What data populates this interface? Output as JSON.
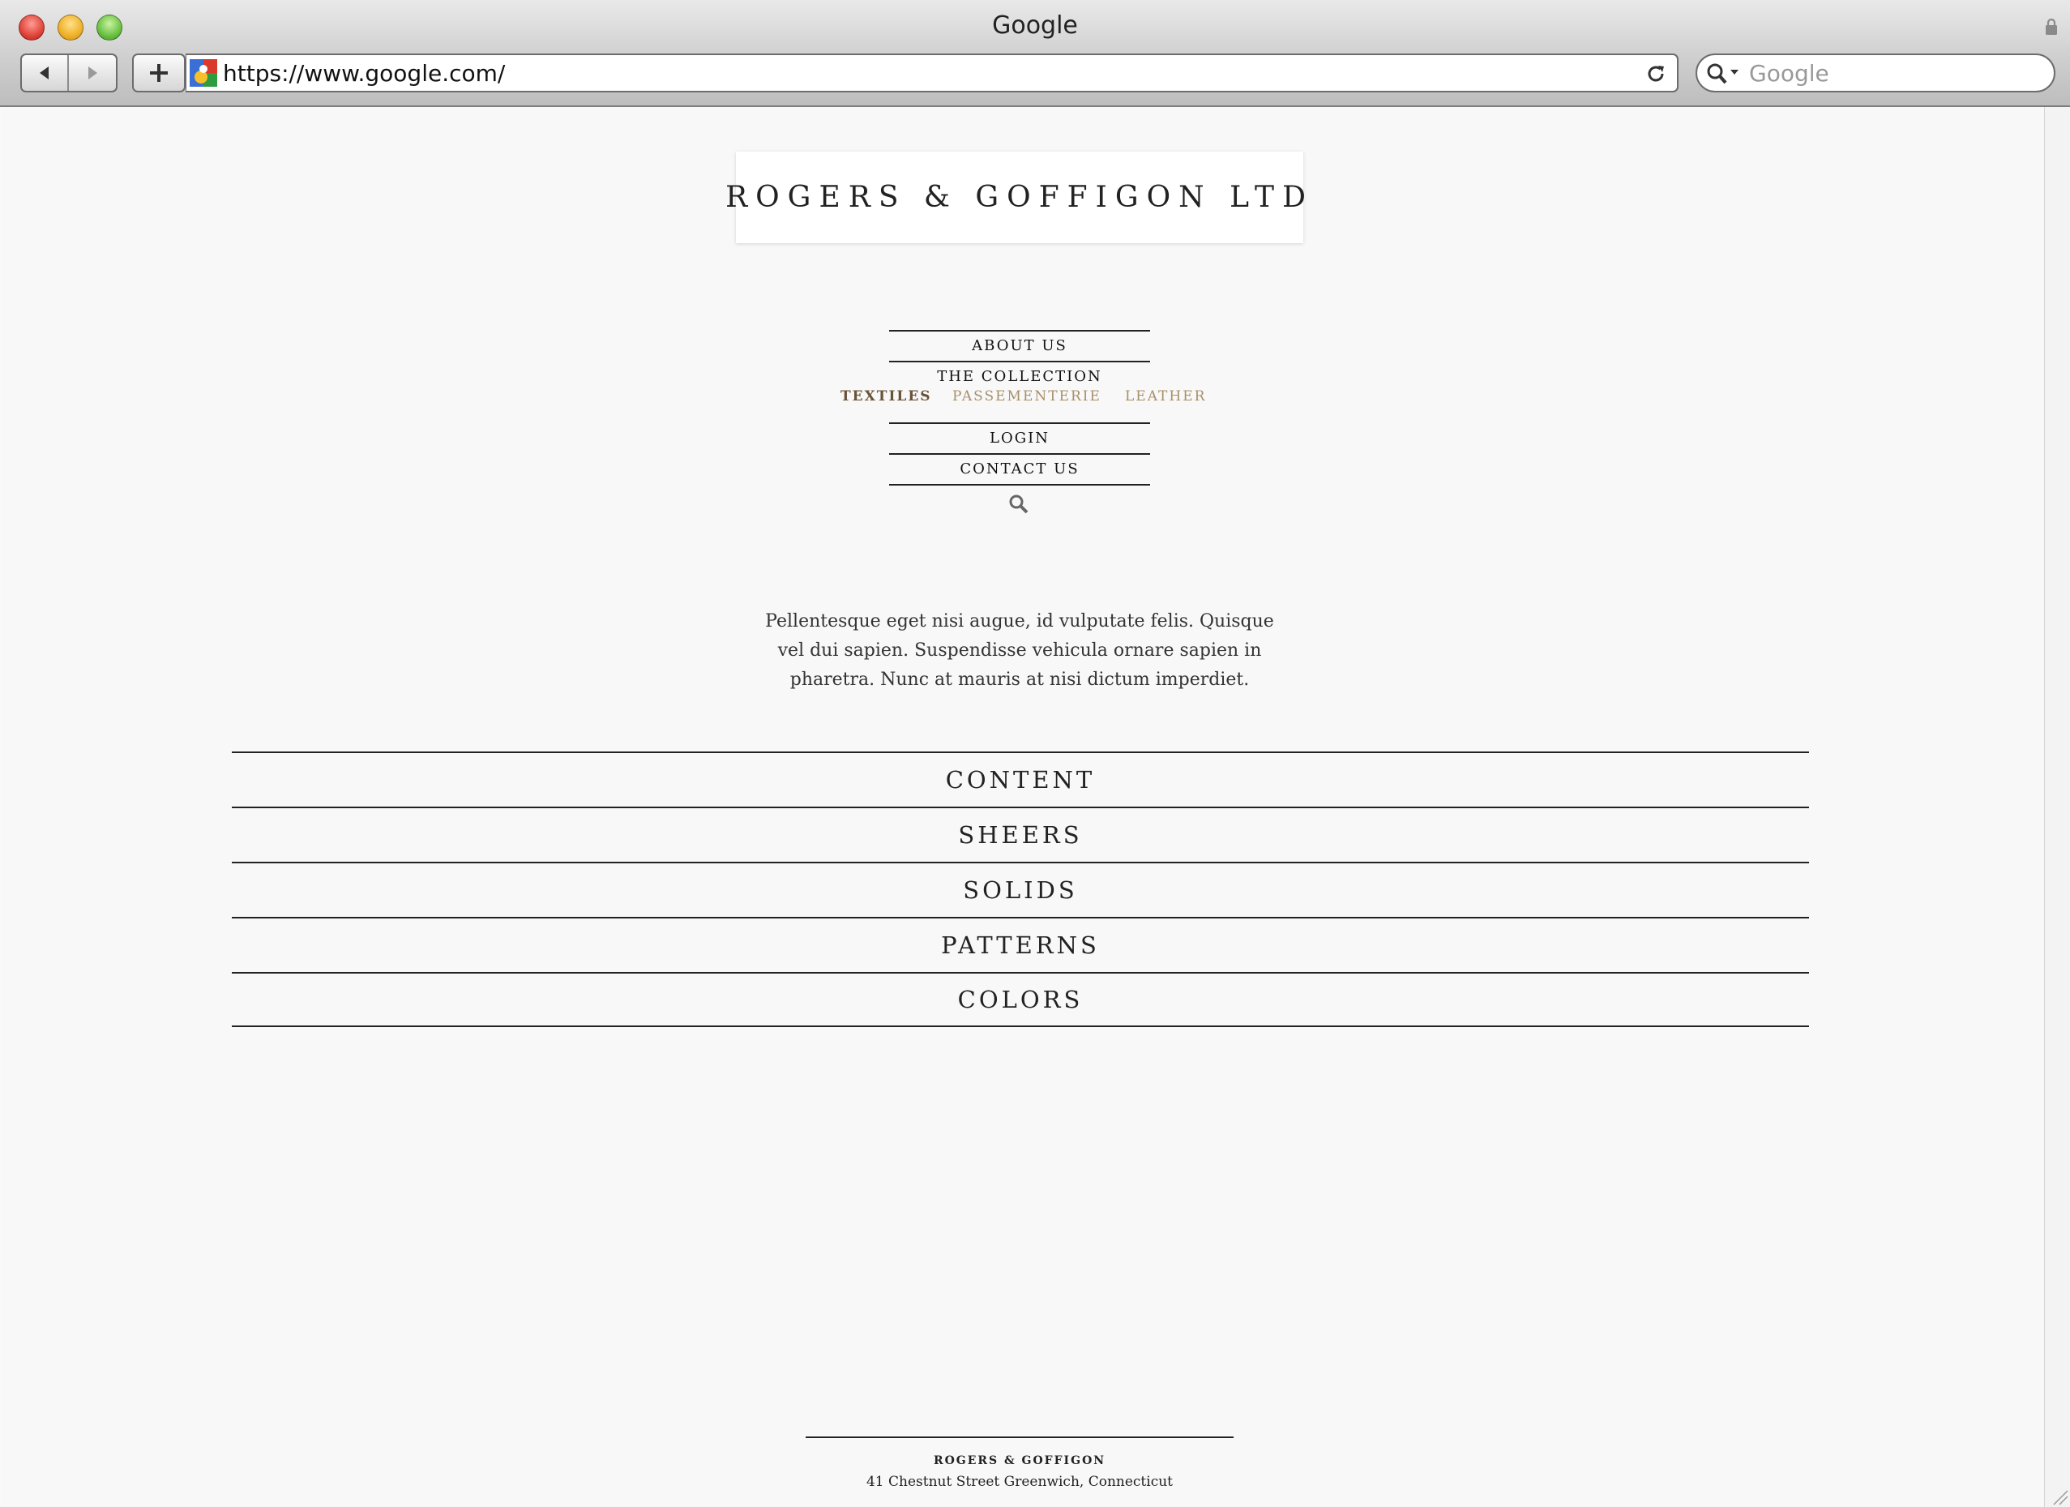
{
  "window": {
    "title": "Google",
    "address": "https://www.google.com/",
    "search_placeholder": "Google"
  },
  "site": {
    "logo": "ROGERS & GOFFIGON LTD",
    "nav": {
      "about": "ABOUT US",
      "collection": "THE COLLECTION",
      "sub": [
        "TEXTILES",
        "PASSEMENTERIE",
        "LEATHER"
      ],
      "login": "LOGIN",
      "contact": "CONTACT US"
    },
    "intro": "Pellentesque eget nisi augue, id vulputate felis. Quisque vel dui sapien. Suspendisse vehicula ornare sapien in pharetra. Nunc at mauris at nisi dictum imperdiet.",
    "categories": [
      "CONTENT",
      "SHEERS",
      "SOLIDS",
      "PATTERNS",
      "COLORS"
    ],
    "footer": {
      "name": "ROGERS & GOFFIGON",
      "address": "41 Chestnut Street  Greenwich, Connecticut"
    }
  },
  "colors": {
    "active_sub": "#6a5238",
    "inactive_sub": "#a88f68",
    "rule": "#222222"
  }
}
